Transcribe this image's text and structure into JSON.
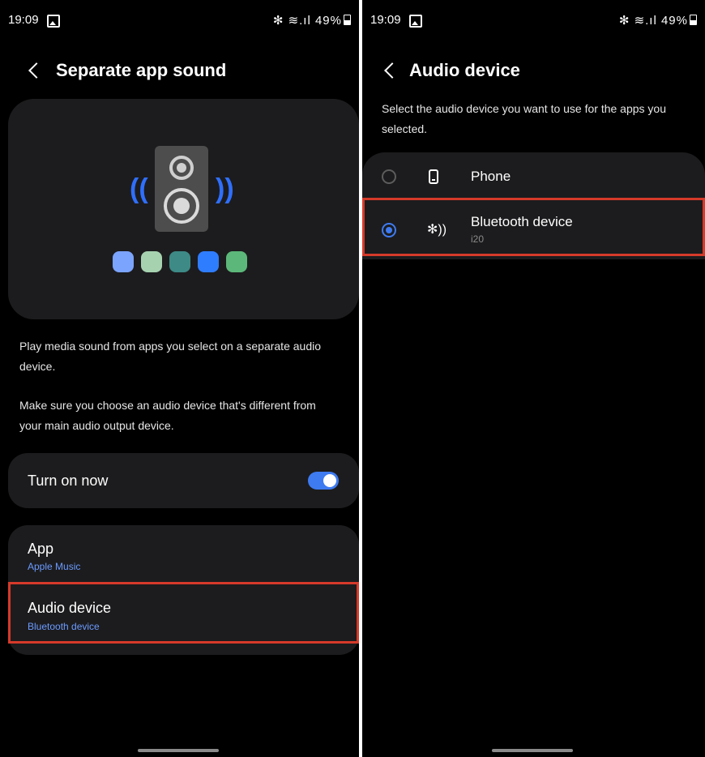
{
  "left": {
    "status": {
      "time": "19:09",
      "right": "✻ ≋.ıl 49%"
    },
    "header": {
      "title": "Separate app sound"
    },
    "illustration": {
      "colors": {
        "speaker": "#4d4d4d",
        "wave": "#2f6fff",
        "dot_colors": [
          "#7ba4ff",
          "#a6d2b0",
          "#3d8a86",
          "#2f7dff",
          "#5cb87a"
        ]
      }
    },
    "description": {
      "p1": "Play media sound from apps you select on a separate audio device.",
      "p2": "Make sure you choose an audio device that's different from your main audio output device."
    },
    "toggle": {
      "label": "Turn on now",
      "state": "on"
    },
    "settings": [
      {
        "title": "App",
        "value": "Apple Music"
      },
      {
        "title": "Audio device",
        "value": "Bluetooth device"
      }
    ]
  },
  "right": {
    "status": {
      "time": "19:09",
      "right": "✻ ≋.ıl 49%"
    },
    "header": {
      "title": "Audio device"
    },
    "description": "Select the audio device you want to use for the apps you selected.",
    "devices": [
      {
        "name": "Phone",
        "sub": "",
        "selected": false,
        "icon": "phone-icon"
      },
      {
        "name": "Bluetooth device",
        "sub": "i20",
        "selected": true,
        "icon": "bluetooth-audio-icon"
      }
    ]
  },
  "colors": {
    "accent": "#3e7bf1",
    "highlight": "#d63a2a",
    "card": "#1c1c1e",
    "subtext_blue": "#6b9bff"
  }
}
